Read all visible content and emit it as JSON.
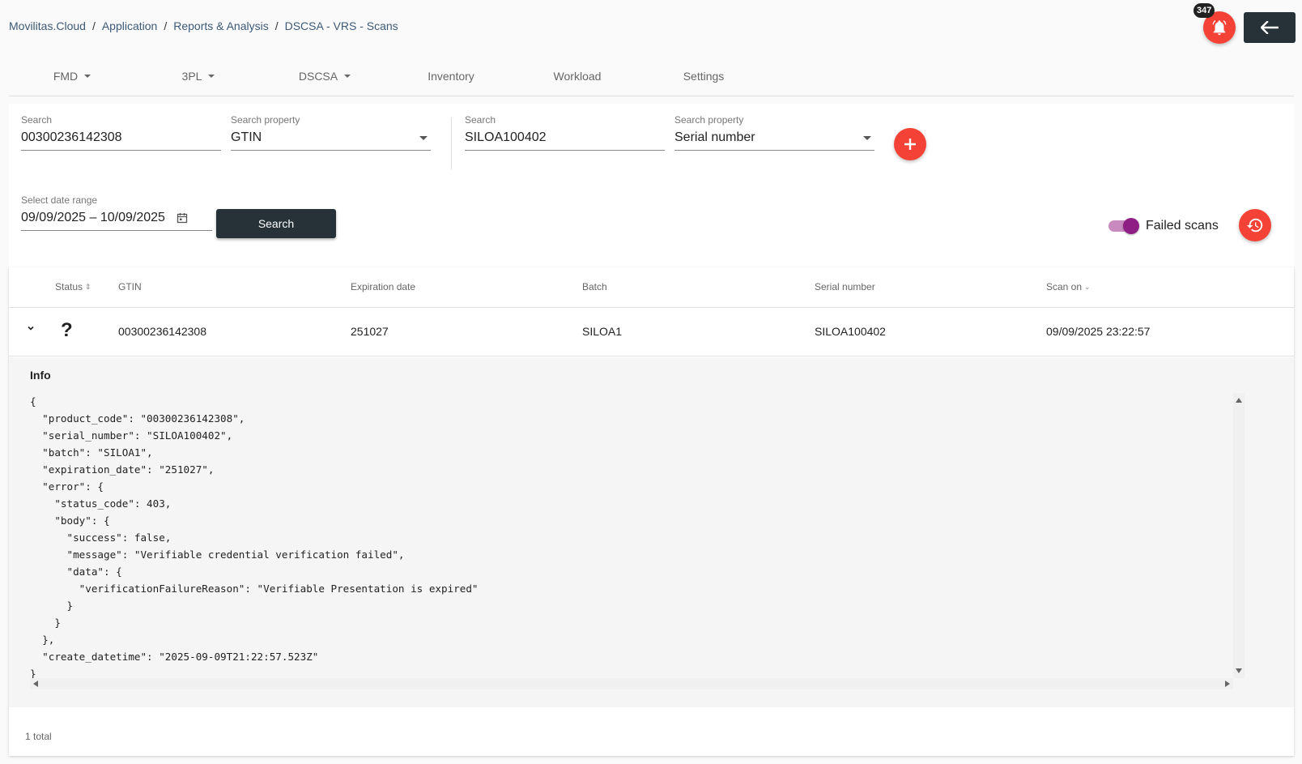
{
  "breadcrumb": [
    "Movilitas.Cloud",
    "Application",
    "Reports & Analysis",
    "DSCSA - VRS - Scans"
  ],
  "header": {
    "notification_count": "347",
    "bell_icon": "bell-icon",
    "back_icon": "arrow-left-icon"
  },
  "nav": {
    "items": [
      {
        "label": "FMD",
        "dropdown": true
      },
      {
        "label": "3PL",
        "dropdown": true
      },
      {
        "label": "DSCSA",
        "dropdown": true
      },
      {
        "label": "Inventory",
        "dropdown": false
      },
      {
        "label": "Workload",
        "dropdown": false
      },
      {
        "label": "Settings",
        "dropdown": false
      }
    ]
  },
  "filters": {
    "search1": {
      "label": "Search",
      "value": "00300236142308"
    },
    "property1": {
      "label": "Search property",
      "value": "GTIN"
    },
    "search2": {
      "label": "Search",
      "value": "SILOA100402"
    },
    "property2": {
      "label": "Search property",
      "value": "Serial number"
    },
    "date_range": {
      "label": "Select date range",
      "value": "09/09/2025 – 10/09/2025"
    },
    "search_button": "Search",
    "failed_scans": {
      "label": "Failed scans",
      "enabled": true
    },
    "colors": {
      "accent": "#f44336",
      "dark": "#263238",
      "toggle": "#8e1f84"
    }
  },
  "table": {
    "headers": {
      "status": "Status",
      "gtin": "GTIN",
      "expiration": "Expiration date",
      "batch": "Batch",
      "serial": "Serial number",
      "scan_on": "Scan on"
    },
    "row": {
      "status": "?",
      "gtin": "00300236142308",
      "expiration": "251027",
      "batch": "SILOA1",
      "serial": "SILOA100402",
      "scan_on": "09/09/2025 23:22:57"
    },
    "info": {
      "title": "Info",
      "json": "{\n  \"product_code\": \"00300236142308\",\n  \"serial_number\": \"SILOA100402\",\n  \"batch\": \"SILOA1\",\n  \"expiration_date\": \"251027\",\n  \"error\": {\n    \"status_code\": 403,\n    \"body\": {\n      \"success\": false,\n      \"message\": \"Verifiable credential verification failed\",\n      \"data\": {\n        \"verificationFailureReason\": \"Verifiable Presentation is expired\"\n      }\n    }\n  },\n  \"create_datetime\": \"2025-09-09T21:22:57.523Z\"\n}"
    },
    "total": "1 total"
  }
}
